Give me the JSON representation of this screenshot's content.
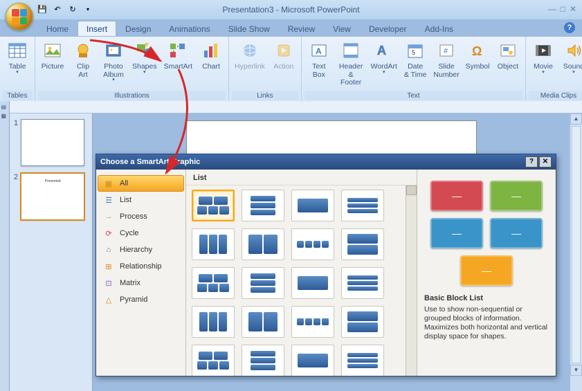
{
  "title": "Presentation3 - Microsoft PowerPoint",
  "tabs": [
    "Home",
    "Insert",
    "Design",
    "Animations",
    "Slide Show",
    "Review",
    "View",
    "Developer",
    "Add-Ins"
  ],
  "active_tab": 1,
  "ribbon": {
    "groups": [
      {
        "label": "Tables",
        "items": [
          {
            "label": "Table",
            "dd": true
          }
        ]
      },
      {
        "label": "Illustrations",
        "items": [
          {
            "label": "Picture"
          },
          {
            "label": "Clip\nArt"
          },
          {
            "label": "Photo\nAlbum",
            "dd": true
          },
          {
            "label": "Shapes",
            "dd": true
          },
          {
            "label": "SmartArt"
          },
          {
            "label": "Chart"
          }
        ]
      },
      {
        "label": "Links",
        "items": [
          {
            "label": "Hyperlink",
            "dim": true
          },
          {
            "label": "Action",
            "dim": true
          }
        ]
      },
      {
        "label": "Text",
        "items": [
          {
            "label": "Text\nBox"
          },
          {
            "label": "Header\n& Footer"
          },
          {
            "label": "WordArt",
            "dd": true
          },
          {
            "label": "Date\n& Time"
          },
          {
            "label": "Slide\nNumber"
          },
          {
            "label": "Symbol"
          },
          {
            "label": "Object"
          }
        ]
      },
      {
        "label": "Media Clips",
        "items": [
          {
            "label": "Movie",
            "dd": true
          },
          {
            "label": "Sound",
            "dd": true
          }
        ]
      }
    ]
  },
  "slides": [
    {
      "num": "1",
      "text": ""
    },
    {
      "num": "2",
      "text": "Presented"
    }
  ],
  "dialog": {
    "title": "Choose a SmartArt Graphic",
    "categories": [
      "All",
      "List",
      "Process",
      "Cycle",
      "Hierarchy",
      "Relationship",
      "Matrix",
      "Pyramid"
    ],
    "active_category": 0,
    "gallery_header": "List",
    "preview": {
      "title": "Basic Block List",
      "desc": "Use to show non-sequential or grouped blocks of information. Maximizes both horizontal and vertical display space for shapes.",
      "colors": [
        "#d44a52",
        "#7eb442",
        "#3a94c9",
        "#3a94c9",
        "#f5a623"
      ]
    }
  }
}
